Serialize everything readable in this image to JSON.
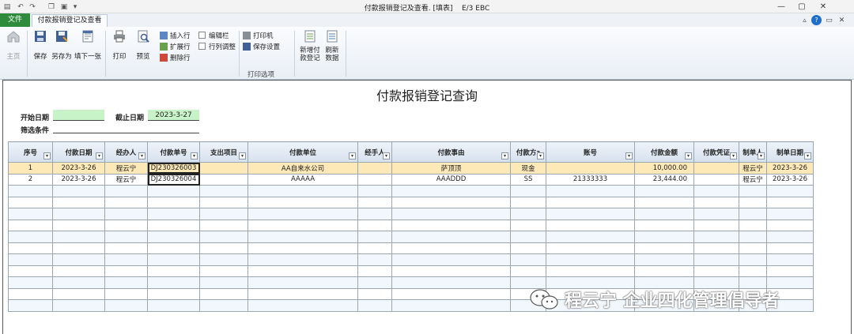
{
  "window": {
    "title": "付款报销登记及查看. [填表]",
    "app": "E/3 EBC"
  },
  "tabs": {
    "file": "文件",
    "active": "付款报销登记及查看"
  },
  "ribbon": {
    "home": "主页",
    "save": "保存",
    "save_as": "另存为",
    "fill_next": "填下一张",
    "print": "打印",
    "preview": "预览",
    "insert_row": "插入行",
    "expand_row": "扩展行",
    "delete_row": "删除行",
    "edit_bar": "编辑栏",
    "row_col_adjust": "行列调整",
    "printer": "打印机",
    "save_settings": "保存设置",
    "print_options": "打印选项",
    "new_payment_l1": "新增付",
    "new_payment_l2": "款登记",
    "refresh_l1": "刷新",
    "refresh_l2": "数据"
  },
  "form": {
    "title": "付款报销登记查询",
    "start_date_label": "开始日期",
    "start_date_value": "",
    "end_date_label": "截止日期",
    "end_date_value": "2023-3-27",
    "filter_label": "筛选条件",
    "filter_value": ""
  },
  "table": {
    "columns": [
      "序号",
      "付款日期",
      "经办人",
      "付款单号",
      "支出项目",
      "付款单位",
      "经手人",
      "付款事由",
      "付款方式",
      "账号",
      "付款金额",
      "付款凭证",
      "制单人",
      "制单日期"
    ],
    "column_display": [
      "序号",
      "付款日期",
      "经办人",
      "付款单号",
      "支出项目",
      "付款单位",
      "经手人",
      "付款事由",
      "付款方ɜ",
      "账号",
      "付款金额",
      "付款凭证",
      "制单人",
      "制单日期"
    ],
    "rows": [
      [
        "1",
        "2023-3-26",
        "程云宁",
        "DJ230326003",
        "",
        "AA自来水公司",
        "",
        "萨顶顶",
        "现金",
        "",
        "10,000.00",
        "",
        "程云宁",
        "2023-3-26"
      ],
      [
        "2",
        "2023-3-26",
        "程云宁",
        "DJ230326004",
        "",
        "AAAAA",
        "",
        "AAADDD",
        "SS",
        "21333333",
        "23,444.00",
        "",
        "程云宁",
        "2023-3-26"
      ]
    ],
    "empty_rows": 11
  },
  "watermark": "程云宁 企业四化管理倡导者",
  "colors": {
    "file_tab": "#2e8b3c",
    "selected_row": "#fde9b8",
    "date_field": "#c8f3c8"
  }
}
